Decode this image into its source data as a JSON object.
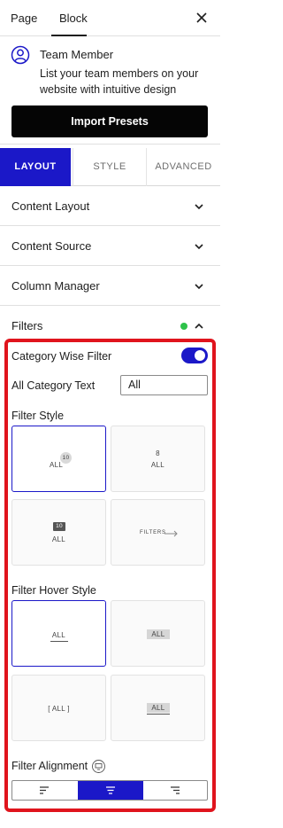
{
  "top_tabs": {
    "page": "Page",
    "block": "Block"
  },
  "block": {
    "title": "Team Member",
    "description": "List your team members on your website with intuitive design",
    "import_button": "Import Presets"
  },
  "panel_tabs": {
    "layout": "LAYOUT",
    "style": "STYLE",
    "advanced": "ADVANCED"
  },
  "sections": {
    "content_layout": "Content Layout",
    "content_source": "Content Source",
    "column_manager": "Column Manager",
    "filters": "Filters"
  },
  "filters": {
    "category_wise_filter": "Category Wise Filter",
    "all_category_text_label": "All Category Text",
    "all_category_text_value": "All",
    "filter_style_label": "Filter Style",
    "filter_style_options": {
      "opt1_text": "ALL",
      "opt1_badge": "10",
      "opt2_count": "8",
      "opt2_text": "ALL",
      "opt3_badge": "10",
      "opt3_text": "ALL",
      "opt4_text": "FILTERS"
    },
    "filter_hover_style_label": "Filter Hover Style",
    "hover_style_options": {
      "opt1_text": "ALL",
      "opt2_text": "ALL",
      "opt3_text": "[ ALL ]",
      "opt4_text": "ALL"
    },
    "filter_alignment_label": "Filter Alignment"
  },
  "colors": {
    "accent": "#1b18c8",
    "highlight": "#e0141d",
    "status_dot": "#2ec24a"
  }
}
